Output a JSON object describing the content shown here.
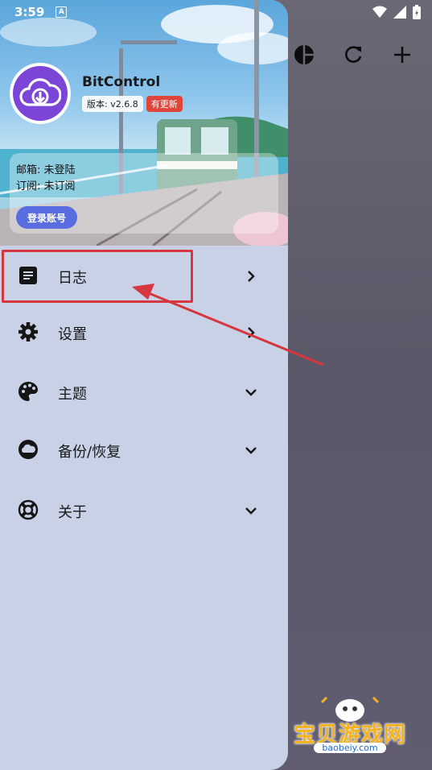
{
  "status_bar": {
    "time": "3:59",
    "badge": "A"
  },
  "profile": {
    "app_name": "BitControl",
    "version_label": "版本: v2.6.8",
    "update_badge": "有更新",
    "email_label": "邮箱: 未登陆",
    "subscription_label": "订阅: 未订阅",
    "login_button": "登录账号"
  },
  "menu": {
    "items": [
      {
        "label": "日志",
        "icon": "log-icon",
        "arrow": "chevron-right"
      },
      {
        "label": "设置",
        "icon": "gear-icon",
        "arrow": "chevron-right"
      },
      {
        "label": "主题",
        "icon": "palette-icon",
        "arrow": "chevron-down"
      },
      {
        "label": "备份/恢复",
        "icon": "cloud-icon",
        "arrow": "chevron-down"
      },
      {
        "label": "关于",
        "icon": "lifebuoy-icon",
        "arrow": "chevron-down"
      }
    ]
  },
  "toolbar": {
    "icons": [
      "pie-chart-icon",
      "refresh-icon",
      "add-icon"
    ]
  },
  "watermark": {
    "text": "宝贝游戏网",
    "url": "baobeiy.com"
  },
  "colors": {
    "drawer_bg": "#c9d1e6",
    "accent": "#5a6de0",
    "update": "#e0453a",
    "highlight": "#d6363e"
  }
}
